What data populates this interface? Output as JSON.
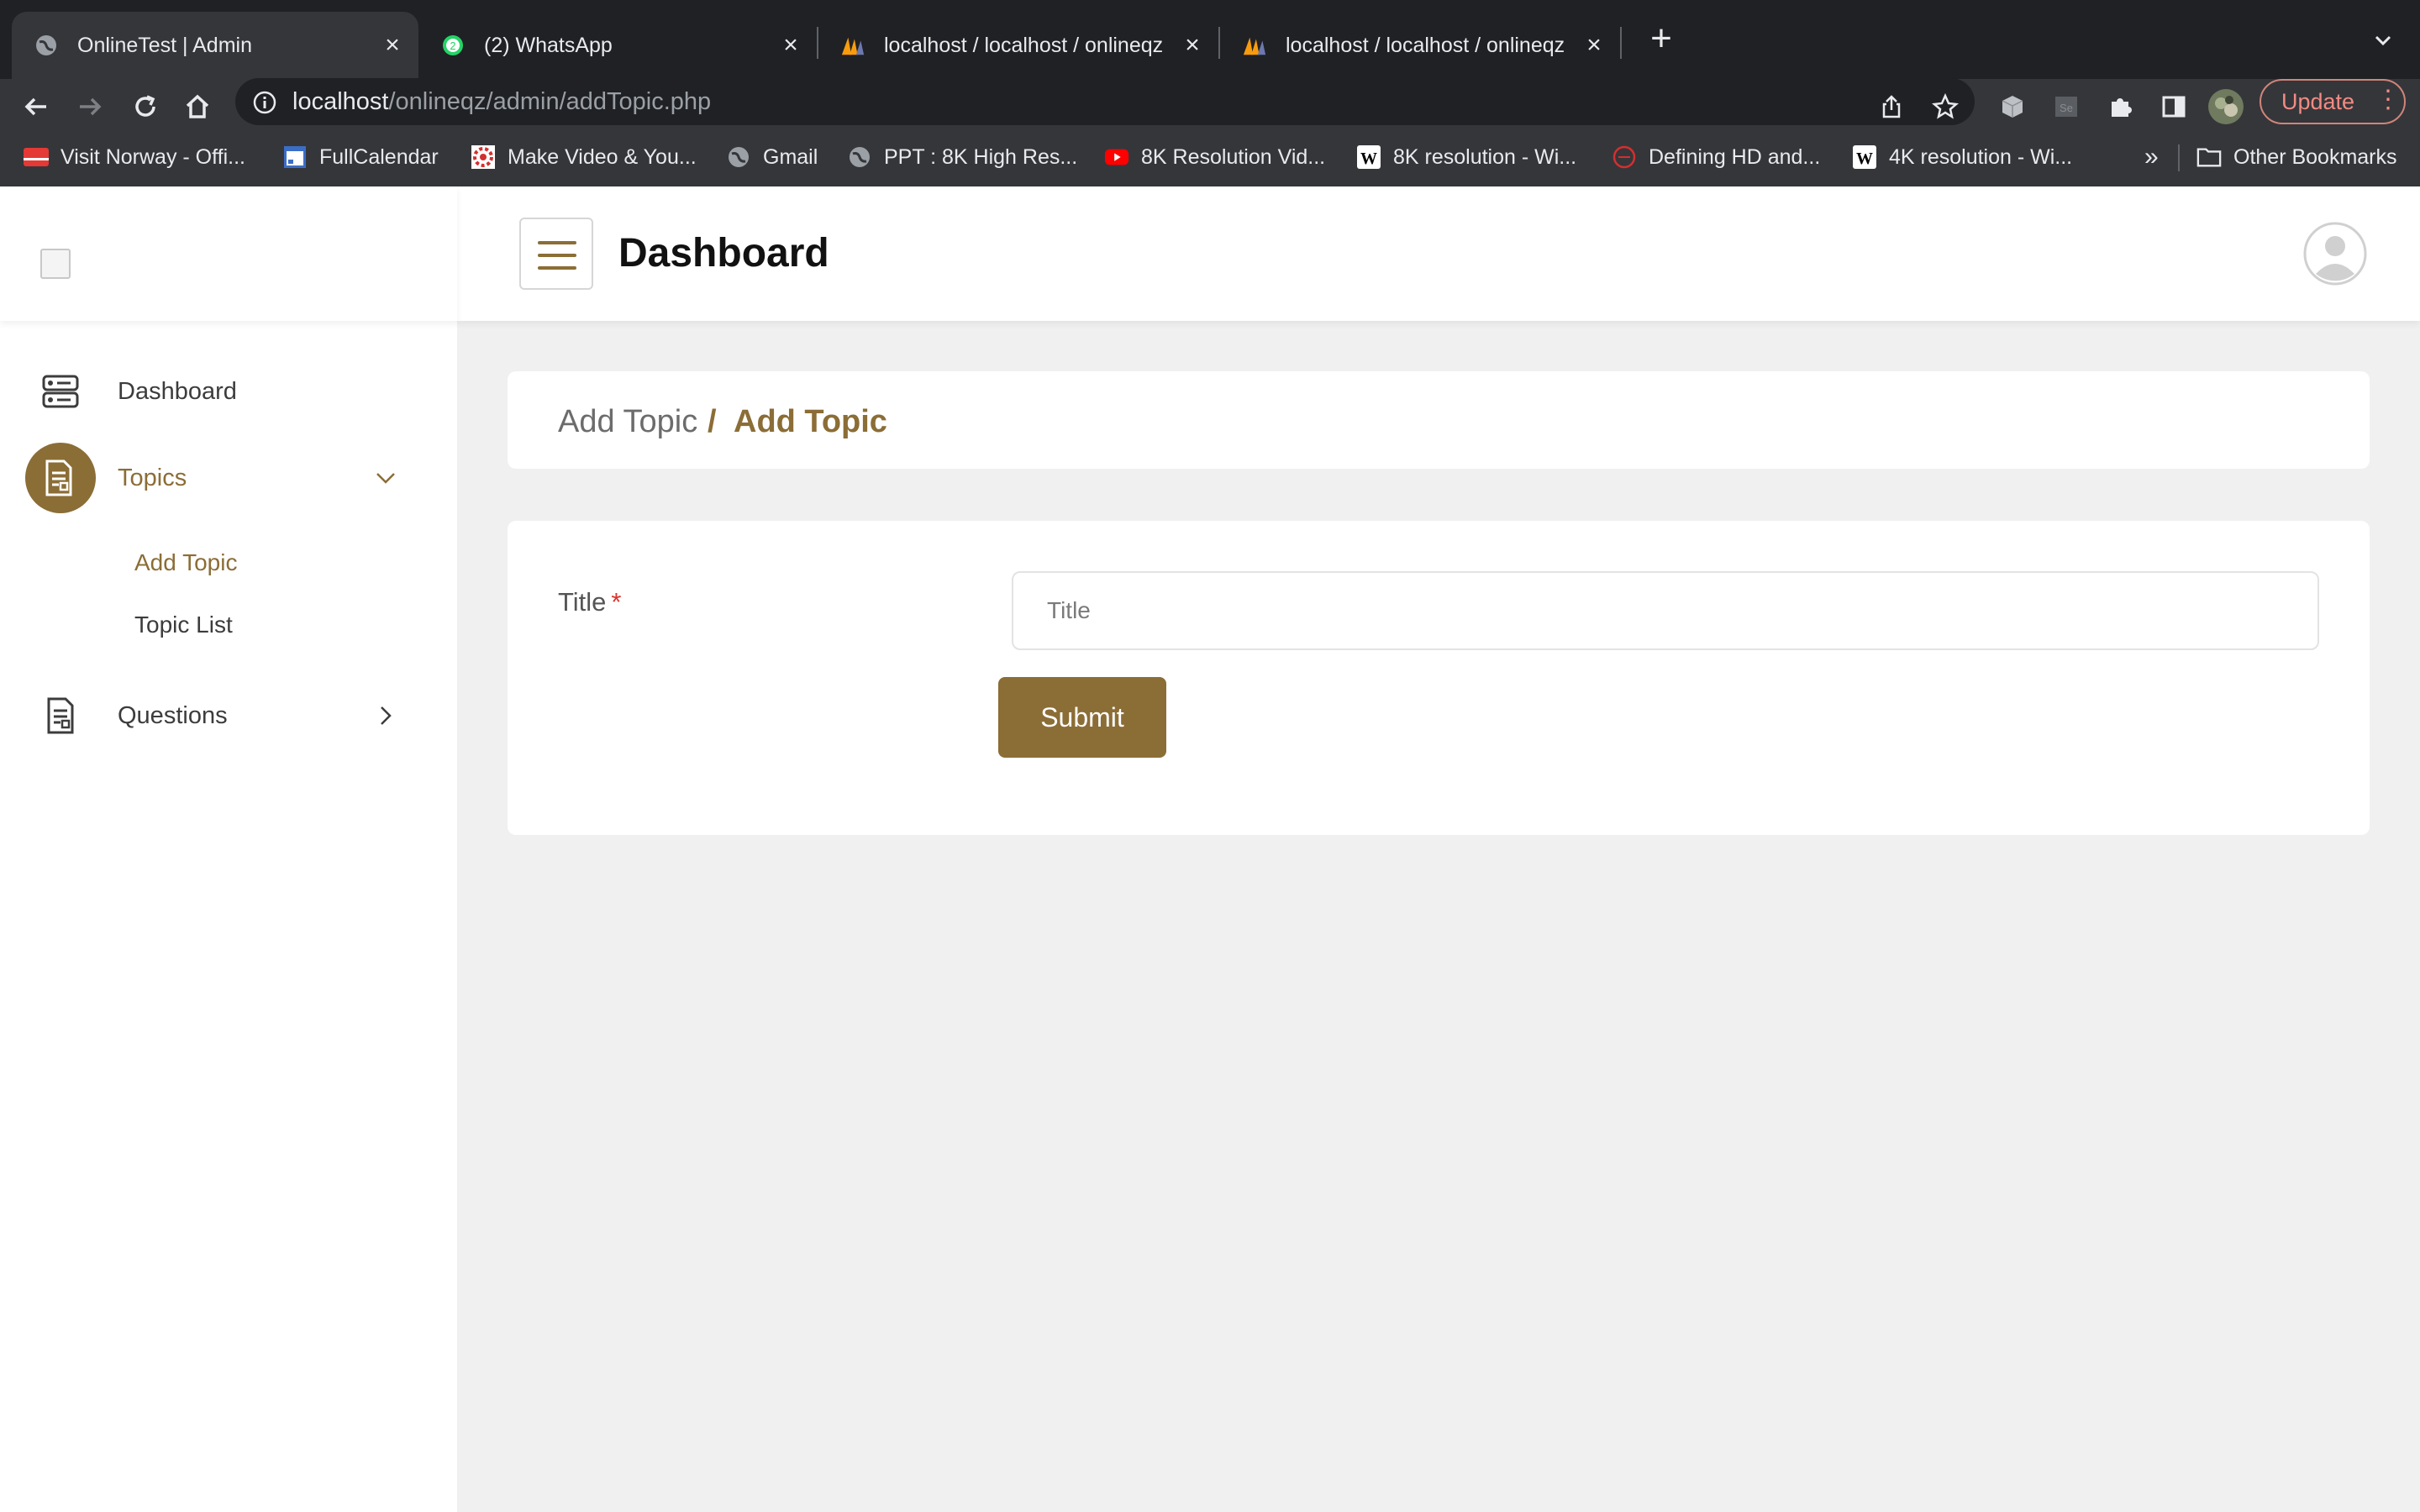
{
  "browser": {
    "tabs": [
      {
        "title": "OnlineTest | Admin",
        "active": true,
        "icon": "globe-icon"
      },
      {
        "title": "(2) WhatsApp",
        "active": false,
        "icon": "whatsapp-icon"
      },
      {
        "title": "localhost / localhost / onlineqz",
        "active": false,
        "icon": "phpmyadmin-icon"
      },
      {
        "title": "localhost / localhost / onlineqz",
        "active": false,
        "icon": "phpmyadmin-icon"
      }
    ],
    "new_tab_label": "+",
    "url_host": "localhost",
    "url_path": "/onlineqz/admin/addTopic.php",
    "update_label": "Update",
    "bookmarks": [
      {
        "label": "Visit Norway - Offi...",
        "icon": "norway-flag-icon"
      },
      {
        "label": "FullCalendar",
        "icon": "calendar-icon"
      },
      {
        "label": "Make Video & You...",
        "icon": "video-icon"
      },
      {
        "label": "Gmail",
        "icon": "globe-icon"
      },
      {
        "label": "PPT : 8K High Res...",
        "icon": "globe-icon"
      },
      {
        "label": "8K Resolution Vid...",
        "icon": "youtube-icon"
      },
      {
        "label": "8K resolution - Wi...",
        "icon": "wikipedia-icon"
      },
      {
        "label": "Defining HD and...",
        "icon": "hd-icon"
      },
      {
        "label": "4K resolution - Wi...",
        "icon": "wikipedia-icon"
      }
    ],
    "bookmarks_more": "»",
    "other_bookmarks": "Other Bookmarks"
  },
  "header": {
    "title": "Dashboard"
  },
  "sidebar": {
    "items": [
      {
        "label": "Dashboard",
        "icon": "dashboard-icon"
      },
      {
        "label": "Topics",
        "icon": "document-icon",
        "expanded": true,
        "children": [
          {
            "label": "Add Topic",
            "active": true
          },
          {
            "label": "Topic List",
            "active": false
          }
        ]
      },
      {
        "label": "Questions",
        "icon": "document-icon",
        "expanded": false
      }
    ]
  },
  "breadcrumb": {
    "parent": "Add Topic",
    "separator": "/",
    "current": "Add Topic"
  },
  "form": {
    "title_label": "Title",
    "required_mark": "*",
    "title_placeholder": "Title",
    "title_value": "",
    "submit_label": "Submit"
  },
  "colors": {
    "accent": "#8b6d36",
    "required": "#d9342b",
    "page_bg": "#f0f0f0",
    "chrome_dark": "#202124",
    "chrome_toolbar": "#35363a"
  }
}
